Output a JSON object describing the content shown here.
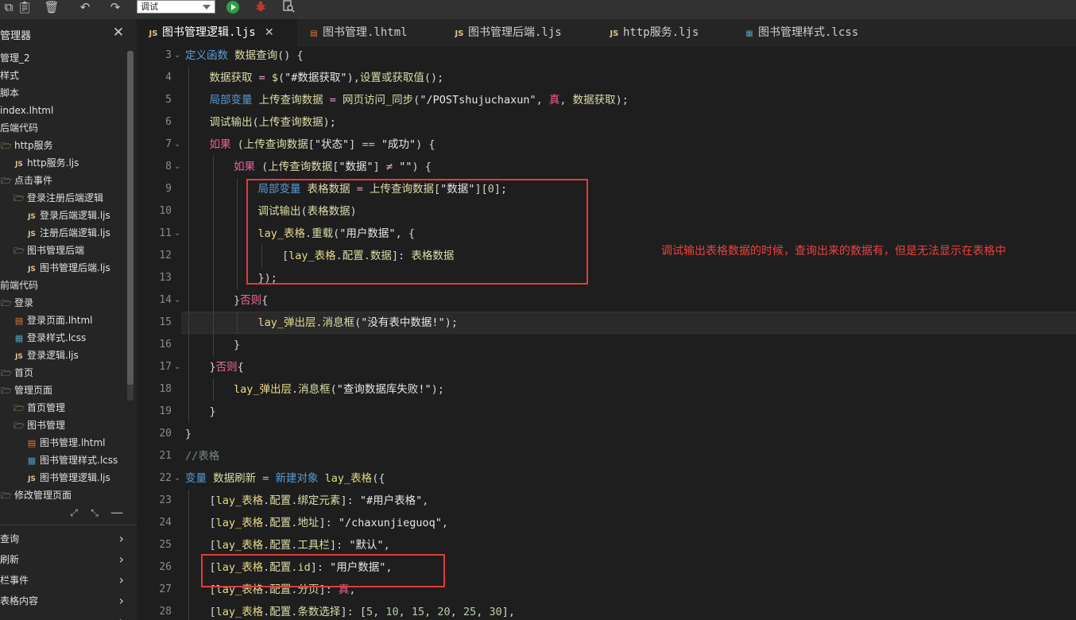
{
  "toolbar": {
    "run_config": "调试",
    "icons": [
      "copy-icon",
      "clipboard-icon",
      "trash-icon",
      "undo-icon",
      "redo-icon",
      "run-icon",
      "debug-icon",
      "search-doc-icon"
    ],
    "run_color": "#2ea043",
    "debug_color": "#c0392b"
  },
  "sidebar": {
    "title": "管理器",
    "items": [
      {
        "label": "管理_2",
        "icon": ""
      },
      {
        "label": "样式",
        "icon": ""
      },
      {
        "label": "脚本",
        "icon": ""
      },
      {
        "label": "index.lhtml",
        "icon": ""
      },
      {
        "label": "后端代码",
        "icon": ""
      },
      {
        "label": "http服务",
        "icon": "folder-icon"
      },
      {
        "label": "http服务.ljs",
        "icon": "js-file-icon"
      },
      {
        "label": "点击事件",
        "icon": "folder-icon"
      },
      {
        "label": "登录注册后端逻辑",
        "icon": "folder-icon"
      },
      {
        "label": "登录后端逻辑.ljs",
        "icon": "js-file-icon"
      },
      {
        "label": "注册后端逻辑.ljs",
        "icon": "js-file-icon"
      },
      {
        "label": "图书管理后端",
        "icon": "folder-icon"
      },
      {
        "label": "图书管理后端.ljs",
        "icon": "js-file-icon"
      },
      {
        "label": "前端代码",
        "icon": ""
      },
      {
        "label": "登录",
        "icon": "folder-icon"
      },
      {
        "label": "登录页面.lhtml",
        "icon": "html-file-icon"
      },
      {
        "label": "登录样式.lcss",
        "icon": "css-file-icon"
      },
      {
        "label": "登录逻辑.ljs",
        "icon": "js-file-icon"
      },
      {
        "label": "首页",
        "icon": "folder-icon"
      },
      {
        "label": "管理页面",
        "icon": "folder-icon"
      },
      {
        "label": "首页管理",
        "icon": "folder-icon"
      },
      {
        "label": "图书管理",
        "icon": "folder-icon"
      },
      {
        "label": "图书管理.lhtml",
        "icon": "html-file-icon"
      },
      {
        "label": "图书管理样式.lcss",
        "icon": "css-file-icon"
      },
      {
        "label": "图书管理逻辑.ljs",
        "icon": "js-file-icon"
      },
      {
        "label": "修改管理页面",
        "icon": "folder-icon"
      }
    ],
    "outline": [
      "查询",
      "刷新",
      "栏事件",
      "表格内容",
      ""
    ]
  },
  "tabs": [
    {
      "label": "图书管理逻辑.ljs",
      "icon": "JS",
      "active": true
    },
    {
      "label": "图书管理.lhtml",
      "icon": "html",
      "active": false
    },
    {
      "label": "图书管理后端.ljs",
      "icon": "JS",
      "active": false
    },
    {
      "label": "http服务.ljs",
      "icon": "JS",
      "active": false
    },
    {
      "label": "图书管理样式.lcss",
      "icon": "css",
      "active": false
    }
  ],
  "editor": {
    "highlighted_line": 15,
    "lines": [
      {
        "n": 3,
        "indent": 0,
        "fold": true,
        "tokens": [
          [
            "kw",
            "定义函数 "
          ],
          [
            "fn",
            "数据查询"
          ],
          [
            "",
            "() {"
          ]
        ]
      },
      {
        "n": 4,
        "indent": 1,
        "fold": false,
        "tokens": [
          [
            "fn",
            "数据获取"
          ],
          [
            "op",
            " = "
          ],
          [
            "fn",
            "$"
          ],
          [
            "",
            "("
          ],
          [
            "str",
            "\"#数据获取\""
          ],
          [
            "",
            "),"
          ],
          [
            "fn",
            "设置或获取值"
          ],
          [
            "",
            "();"
          ]
        ]
      },
      {
        "n": 5,
        "indent": 1,
        "fold": false,
        "tokens": [
          [
            "kw",
            "局部变量 "
          ],
          [
            "fn",
            "上传查询数据"
          ],
          [
            "op",
            " = "
          ],
          [
            "fn",
            "网页访问_同步"
          ],
          [
            "",
            "("
          ],
          [
            "str",
            "\"/POSTshujuchaxun\""
          ],
          [
            "",
            ", "
          ],
          [
            "bool",
            "真"
          ],
          [
            "",
            ", "
          ],
          [
            "fn",
            "数据获取"
          ],
          [
            "",
            ");"
          ]
        ]
      },
      {
        "n": 6,
        "indent": 1,
        "fold": false,
        "tokens": [
          [
            "fn",
            "调试输出"
          ],
          [
            "",
            "("
          ],
          [
            "fn",
            "上传查询数据"
          ],
          [
            "",
            ");"
          ]
        ]
      },
      {
        "n": 7,
        "indent": 1,
        "fold": true,
        "tokens": [
          [
            "bool",
            "如果"
          ],
          [
            "",
            " ("
          ],
          [
            "fn",
            "上传查询数据"
          ],
          [
            "",
            "["
          ],
          [
            "str",
            "\"状态\""
          ],
          [
            "",
            "] "
          ],
          [
            "op",
            "=="
          ],
          [
            "",
            " "
          ],
          [
            "str",
            "\"成功\""
          ],
          [
            "",
            ") {"
          ]
        ]
      },
      {
        "n": 8,
        "indent": 2,
        "fold": true,
        "tokens": [
          [
            "bool",
            "如果"
          ],
          [
            "",
            " ("
          ],
          [
            "fn",
            "上传查询数据"
          ],
          [
            "",
            "["
          ],
          [
            "str",
            "\"数据\""
          ],
          [
            "",
            "] "
          ],
          [
            "op",
            "≠"
          ],
          [
            "",
            " "
          ],
          [
            "str",
            "\"\""
          ],
          [
            "",
            ") {"
          ]
        ]
      },
      {
        "n": 9,
        "indent": 3,
        "fold": false,
        "tokens": [
          [
            "kw",
            "局部变量 "
          ],
          [
            "fn",
            "表格数据"
          ],
          [
            "op",
            " = "
          ],
          [
            "fn",
            "上传查询数据"
          ],
          [
            "",
            "["
          ],
          [
            "str",
            "\"数据\""
          ],
          [
            "",
            "]["
          ],
          [
            "num",
            "0"
          ],
          [
            "",
            "];"
          ]
        ]
      },
      {
        "n": 10,
        "indent": 3,
        "fold": false,
        "tokens": [
          [
            "fn",
            "调试输出"
          ],
          [
            "",
            "("
          ],
          [
            "fn",
            "表格数据"
          ],
          [
            "",
            ")"
          ]
        ]
      },
      {
        "n": 11,
        "indent": 3,
        "fold": true,
        "tokens": [
          [
            "lay",
            "lay_表格"
          ],
          [
            "",
            "."
          ],
          [
            "fn",
            "重载"
          ],
          [
            "",
            "("
          ],
          [
            "str",
            "\"用户数据\""
          ],
          [
            "",
            ", {"
          ]
        ]
      },
      {
        "n": 12,
        "indent": 4,
        "fold": false,
        "tokens": [
          [
            "",
            "["
          ],
          [
            "lay",
            "lay_表格"
          ],
          [
            "",
            "."
          ],
          [
            "fn",
            "配置"
          ],
          [
            "",
            "."
          ],
          [
            "fn",
            "数据"
          ],
          [
            "",
            "]: "
          ],
          [
            "fn",
            "表格数据"
          ]
        ]
      },
      {
        "n": 13,
        "indent": 3,
        "fold": false,
        "tokens": [
          [
            "",
            "});"
          ]
        ]
      },
      {
        "n": 14,
        "indent": 2,
        "fold": true,
        "tokens": [
          [
            "",
            "}"
          ],
          [
            "else",
            "否则"
          ],
          [
            "",
            "{"
          ]
        ]
      },
      {
        "n": 15,
        "indent": 3,
        "fold": false,
        "tokens": [
          [
            "lay",
            "lay_弹出层"
          ],
          [
            "",
            "."
          ],
          [
            "fn",
            "消息框"
          ],
          [
            "",
            "("
          ],
          [
            "str",
            "\"没有表中数据!\""
          ],
          [
            "",
            ");"
          ]
        ]
      },
      {
        "n": 16,
        "indent": 2,
        "fold": false,
        "tokens": [
          [
            "",
            "}"
          ]
        ]
      },
      {
        "n": 17,
        "indent": 1,
        "fold": true,
        "tokens": [
          [
            "",
            "}"
          ],
          [
            "else",
            "否则"
          ],
          [
            "",
            "{"
          ]
        ]
      },
      {
        "n": 18,
        "indent": 2,
        "fold": false,
        "tokens": [
          [
            "lay",
            "lay_弹出层"
          ],
          [
            "",
            "."
          ],
          [
            "fn",
            "消息框"
          ],
          [
            "",
            "("
          ],
          [
            "str",
            "\"查询数据库失败!\""
          ],
          [
            "",
            ");"
          ]
        ]
      },
      {
        "n": 19,
        "indent": 1,
        "fold": false,
        "tokens": [
          [
            "",
            "}"
          ]
        ]
      },
      {
        "n": 20,
        "indent": 0,
        "fold": false,
        "tokens": [
          [
            "",
            "}"
          ]
        ]
      },
      {
        "n": 21,
        "indent": 0,
        "fold": false,
        "tokens": [
          [
            "cmt",
            "//表格"
          ]
        ]
      },
      {
        "n": 22,
        "indent": 0,
        "fold": true,
        "tokens": [
          [
            "kw",
            "变量 "
          ],
          [
            "fn",
            "数据刷新"
          ],
          [
            "op",
            " = "
          ],
          [
            "kw",
            "新建对象 "
          ],
          [
            "lay",
            "lay_表格"
          ],
          [
            "",
            "({"
          ]
        ]
      },
      {
        "n": 23,
        "indent": 1,
        "fold": false,
        "tokens": [
          [
            "",
            "["
          ],
          [
            "lay",
            "lay_表格"
          ],
          [
            "",
            "."
          ],
          [
            "fn",
            "配置"
          ],
          [
            "",
            "."
          ],
          [
            "fn",
            "绑定元素"
          ],
          [
            "",
            "]: "
          ],
          [
            "str",
            "\"#用户表格\""
          ],
          [
            "",
            ","
          ]
        ]
      },
      {
        "n": 24,
        "indent": 1,
        "fold": false,
        "tokens": [
          [
            "",
            "["
          ],
          [
            "lay",
            "lay_表格"
          ],
          [
            "",
            "."
          ],
          [
            "fn",
            "配置"
          ],
          [
            "",
            "."
          ],
          [
            "fn",
            "地址"
          ],
          [
            "",
            "]: "
          ],
          [
            "str",
            "\"/chaxunjieguoq\""
          ],
          [
            "",
            ","
          ]
        ]
      },
      {
        "n": 25,
        "indent": 1,
        "fold": false,
        "tokens": [
          [
            "",
            "["
          ],
          [
            "lay",
            "lay_表格"
          ],
          [
            "",
            "."
          ],
          [
            "fn",
            "配置"
          ],
          [
            "",
            "."
          ],
          [
            "fn",
            "工具栏"
          ],
          [
            "",
            "]: "
          ],
          [
            "str",
            "\"默认\""
          ],
          [
            "",
            ","
          ]
        ]
      },
      {
        "n": 26,
        "indent": 1,
        "fold": false,
        "tokens": [
          [
            "",
            "["
          ],
          [
            "lay",
            "lay_表格"
          ],
          [
            "",
            "."
          ],
          [
            "fn",
            "配置"
          ],
          [
            "",
            "."
          ],
          [
            "fn",
            "id"
          ],
          [
            "",
            "]: "
          ],
          [
            "str",
            "\"用户数据\""
          ],
          [
            "",
            ","
          ]
        ]
      },
      {
        "n": 27,
        "indent": 1,
        "fold": false,
        "tokens": [
          [
            "",
            "["
          ],
          [
            "lay",
            "lay_表格"
          ],
          [
            "",
            "."
          ],
          [
            "fn",
            "配置"
          ],
          [
            "",
            "."
          ],
          [
            "fn",
            "分页"
          ],
          [
            "",
            "]: "
          ],
          [
            "bool",
            "真"
          ],
          [
            "",
            ","
          ]
        ]
      },
      {
        "n": 28,
        "indent": 1,
        "fold": false,
        "tokens": [
          [
            "",
            "["
          ],
          [
            "lay",
            "lay_表格"
          ],
          [
            "",
            "."
          ],
          [
            "fn",
            "配置"
          ],
          [
            "",
            "."
          ],
          [
            "fn",
            "条数选择"
          ],
          [
            "",
            "]: ["
          ],
          [
            "num",
            "5"
          ],
          [
            "",
            ", "
          ],
          [
            "num",
            "10"
          ],
          [
            "",
            ", "
          ],
          [
            "num",
            "15"
          ],
          [
            "",
            ", "
          ],
          [
            "num",
            "20"
          ],
          [
            "",
            ", "
          ],
          [
            "num",
            "25"
          ],
          [
            "",
            ", "
          ],
          [
            "num",
            "30"
          ],
          [
            "",
            "],"
          ]
        ]
      }
    ]
  },
  "annotation": "调试输出表格数据的时候，查询出来的数据有，但是无法显示在表格中",
  "annotation_color": "#f0403c"
}
